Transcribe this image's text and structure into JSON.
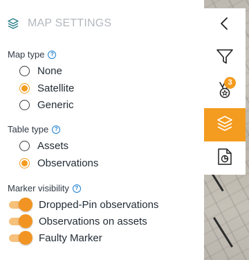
{
  "panel": {
    "title": "MAP SETTINGS",
    "help_glyph": "?",
    "map_type": {
      "label": "Map type",
      "options": [
        {
          "label": "None",
          "selected": false
        },
        {
          "label": "Satellite",
          "selected": true
        },
        {
          "label": "Generic",
          "selected": false
        }
      ]
    },
    "table_type": {
      "label": "Table type",
      "options": [
        {
          "label": "Assets",
          "selected": false
        },
        {
          "label": "Observations",
          "selected": true
        }
      ]
    },
    "marker_visibility": {
      "label": "Marker visibility",
      "toggles": [
        {
          "label": "Dropped-Pin observations",
          "on": true
        },
        {
          "label": "Observations on assets",
          "on": true
        },
        {
          "label": "Faulty Marker",
          "on": true
        }
      ]
    }
  },
  "toolbar": {
    "items": [
      {
        "icon": "chevron-left-icon"
      },
      {
        "icon": "filter-icon"
      },
      {
        "icon": "medal-icon",
        "badge": "3"
      },
      {
        "icon": "layers-icon",
        "active": true
      },
      {
        "icon": "report-chart-icon"
      }
    ]
  },
  "colors": {
    "accent": "#f39c1f",
    "title_gray": "#b3b8bd",
    "help_blue": "#1b7fd0",
    "layers_teal": "#2a7d8a"
  }
}
